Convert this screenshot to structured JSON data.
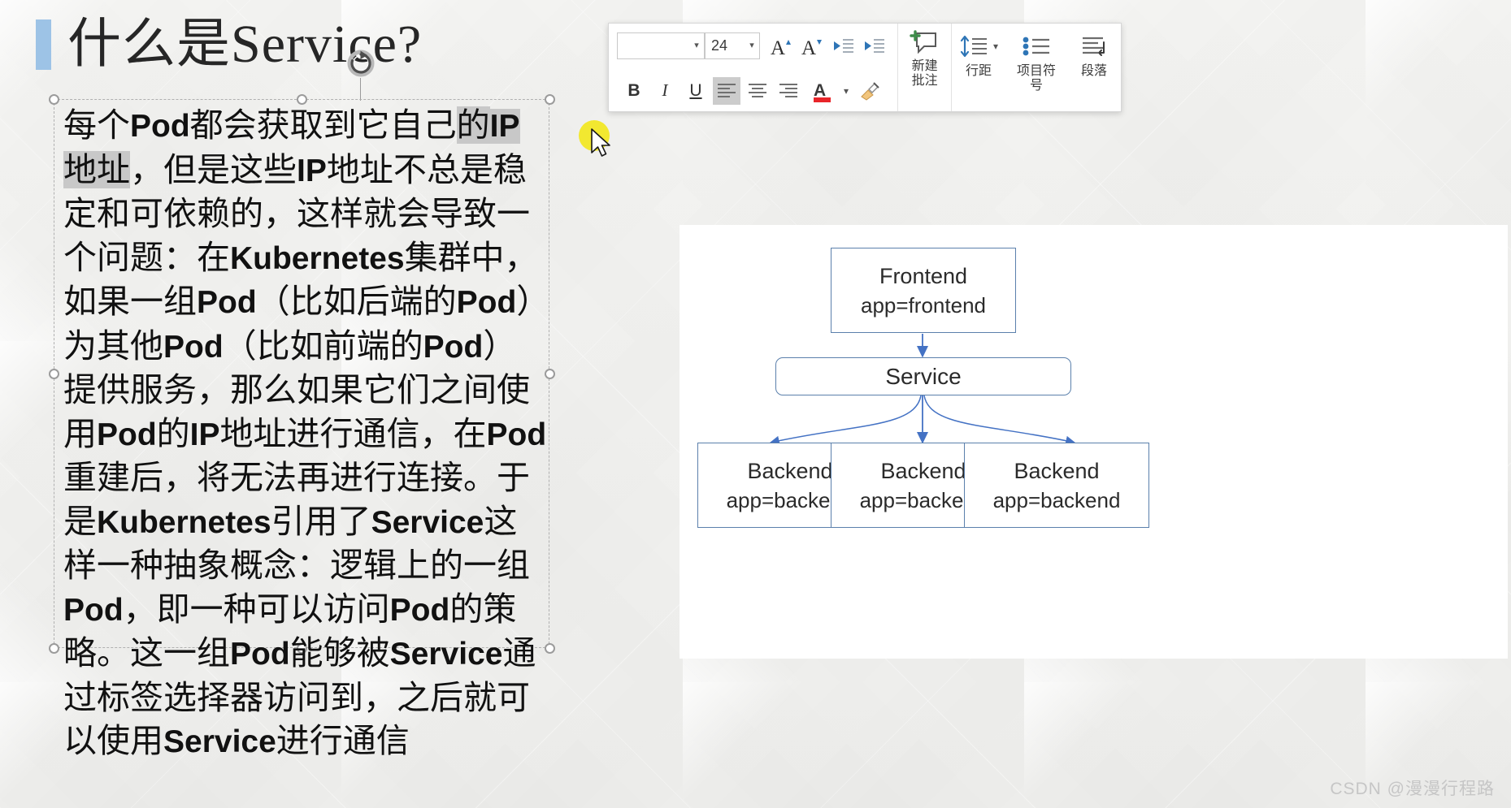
{
  "slide": {
    "title": "什么是Service?",
    "accent_color": "#9dc3e6",
    "background_color": "#f1f1ef"
  },
  "textbox": {
    "segments": [
      {
        "text": "每个",
        "style": "cn"
      },
      {
        "text": "Pod",
        "style": "lat"
      },
      {
        "text": "都会获取到它自己",
        "style": "cn"
      },
      {
        "text": "的",
        "style": "cn-selected"
      },
      {
        "text": "IP",
        "style": "lat-selected"
      },
      {
        "text": "地址",
        "style": "cn-selected"
      },
      {
        "text": "，但是这些",
        "style": "cn"
      },
      {
        "text": "IP",
        "style": "lat"
      },
      {
        "text": "地址不总是稳定和可依赖的，这样就会导致一个问题：在",
        "style": "cn"
      },
      {
        "text": "Kubernetes",
        "style": "lat"
      },
      {
        "text": "集群中，如果一组",
        "style": "cn"
      },
      {
        "text": "Pod",
        "style": "lat"
      },
      {
        "text": "（比如后端的",
        "style": "cn"
      },
      {
        "text": "Pod",
        "style": "lat"
      },
      {
        "text": "）为其他",
        "style": "cn"
      },
      {
        "text": "Pod",
        "style": "lat"
      },
      {
        "text": "（比如前端的",
        "style": "cn"
      },
      {
        "text": "Pod",
        "style": "lat"
      },
      {
        "text": "）提供服务，那么如果它们之间使用",
        "style": "cn"
      },
      {
        "text": "Pod",
        "style": "lat"
      },
      {
        "text": "的",
        "style": "cn"
      },
      {
        "text": "IP",
        "style": "lat"
      },
      {
        "text": "地址进行通信，在",
        "style": "cn"
      },
      {
        "text": "Pod",
        "style": "lat"
      },
      {
        "text": "重建后，将无法再进行连接。于是",
        "style": "cn"
      },
      {
        "text": "Kubernetes",
        "style": "lat"
      },
      {
        "text": "引用了",
        "style": "cn"
      },
      {
        "text": "Service",
        "style": "lat"
      },
      {
        "text": "这样一种抽象概念：逻辑上的一组",
        "style": "cn"
      },
      {
        "text": "Pod",
        "style": "lat"
      },
      {
        "text": "，即一种可以访问",
        "style": "cn"
      },
      {
        "text": "Pod",
        "style": "lat"
      },
      {
        "text": "的策略。这一组",
        "style": "cn"
      },
      {
        "text": "Pod",
        "style": "lat"
      },
      {
        "text": "能够被",
        "style": "cn"
      },
      {
        "text": "Service",
        "style": "lat"
      },
      {
        "text": "通过标签选择器访问到，之后就可以使用",
        "style": "cn"
      },
      {
        "text": "Service",
        "style": "lat"
      },
      {
        "text": "进行通信",
        "style": "cn"
      }
    ],
    "selection_highlight_color": "#c8c8c8"
  },
  "toolbar": {
    "font_name_value": "",
    "font_name_placeholder": "",
    "font_size_value": "24",
    "grow_font_label": "A",
    "shrink_font_label": "A",
    "decrease_indent_label": "",
    "increase_indent_label": "",
    "bold_label": "B",
    "italic_label": "I",
    "underline_label": "U",
    "align_left_label": "",
    "align_center_label": "",
    "align_right_label": "",
    "font_color_label": "A",
    "font_color_swatch": "#e8252a",
    "format_painter_label": "",
    "new_comment_label": "新建\n批注",
    "new_comment_label_line1": "新建",
    "new_comment_label_line2": "批注",
    "line_spacing_label": "行距",
    "bullets_label_line1": "项目符",
    "bullets_label_line2": "号",
    "paragraph_label": "段落"
  },
  "diagram": {
    "frontend": {
      "line1": "Frontend",
      "line2": "app=frontend"
    },
    "service": {
      "line1": "Service"
    },
    "backends": [
      {
        "line1": "Backend",
        "line2": "app=backend"
      },
      {
        "line1": "Backend",
        "line2": "app=backend"
      },
      {
        "line1": "Backend",
        "line2": "app=backend"
      }
    ],
    "box_border_color": "#5b80ac",
    "arrow_color": "#4472c4"
  },
  "watermark": {
    "text": "CSDN @漫漫行程路"
  }
}
